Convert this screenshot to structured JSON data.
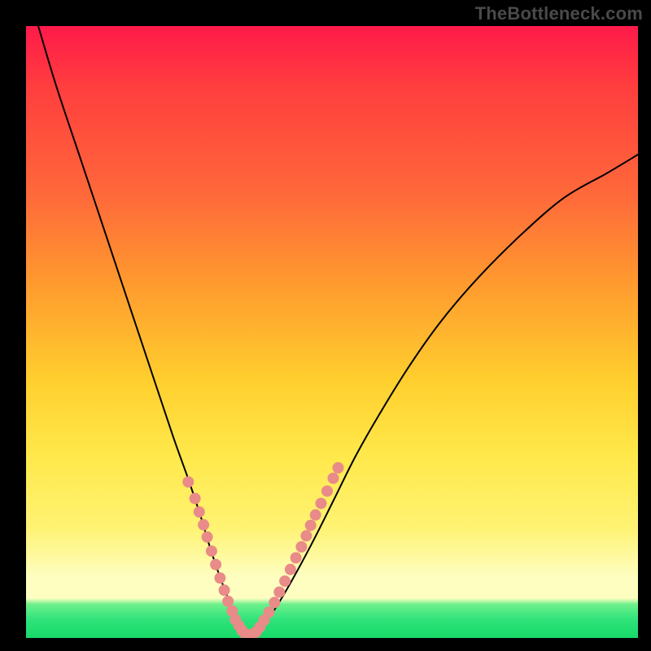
{
  "watermark": "TheBottleneck.com",
  "colors": {
    "curve": "#000000",
    "dot_fill": "#e98b88",
    "dot_stroke": "#e98b88",
    "bg_top": "#ff1a4a",
    "bg_bottom": "#17d968",
    "frame": "#000000"
  },
  "chart_data": {
    "type": "line",
    "title": "",
    "xlabel": "",
    "ylabel": "",
    "xlim": [
      0,
      100
    ],
    "ylim": [
      0,
      100
    ],
    "grid": false,
    "legend": false,
    "notes": "Bottleneck-style curve. One V-shaped black curve on a red→green vertical gradient. Pink dots mark sample points along the curve near the trough. No axes, ticks, or numeric labels are shown; all numeric values below are estimated from pixel positions in a 0–100 normalized space.",
    "series": [
      {
        "name": "bottleneck-curve",
        "kind": "curve",
        "x": [
          2,
          5,
          9,
          13,
          17,
          21,
          24,
          26.5,
          28.5,
          30,
          31.5,
          33,
          34.2,
          35.2,
          36,
          37,
          38.2,
          40.5,
          43.5,
          47,
          50.5,
          54,
          58,
          63,
          68,
          74,
          81,
          88,
          95,
          100
        ],
        "y": [
          100,
          90,
          78,
          66,
          54,
          42,
          33,
          26,
          20,
          15,
          10.5,
          6.5,
          3.5,
          1.6,
          0.6,
          0.6,
          1.6,
          4.5,
          9.5,
          16,
          23,
          30,
          37,
          45,
          52,
          59,
          66,
          72,
          76,
          79
        ]
      },
      {
        "name": "sample-dots",
        "kind": "scatter",
        "x": [
          26.5,
          27.6,
          28.3,
          29.0,
          29.6,
          30.3,
          31.0,
          31.7,
          32.4,
          33.0,
          33.7,
          34.2,
          34.8,
          35.3,
          35.8,
          36.4,
          37.0,
          37.6,
          38.2,
          38.9,
          39.7,
          40.6,
          41.4,
          42.3,
          43.2,
          44.1,
          45.0,
          45.8,
          46.5,
          47.3,
          48.2,
          49.2,
          50.2,
          51.0
        ],
        "y": [
          25.5,
          22.8,
          20.6,
          18.5,
          16.5,
          14.2,
          12.0,
          9.8,
          7.8,
          6.0,
          4.4,
          3.0,
          2.0,
          1.2,
          0.7,
          0.5,
          0.6,
          1.0,
          1.8,
          2.9,
          4.2,
          5.8,
          7.5,
          9.3,
          11.2,
          13.1,
          14.9,
          16.7,
          18.4,
          20.1,
          22.0,
          24.0,
          26.1,
          27.8
        ]
      }
    ]
  }
}
